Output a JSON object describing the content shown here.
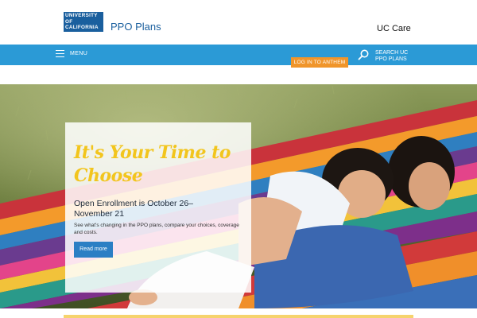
{
  "header": {
    "logo_lines": [
      "UNIVERSITY",
      "OF",
      "CALIFORNIA"
    ],
    "site_title": "PPO Plans",
    "uc_care": "UC Care"
  },
  "nav": {
    "menu_label": "MENU",
    "login_label": "LOG IN TO ANTHEM",
    "search_label_line1": "SEARCH UC",
    "search_label_line2": "PPO PLANS",
    "search_icon": "search-icon",
    "menu_icon": "hamburger-icon"
  },
  "hero": {
    "headline": "It's Your Time to Choose",
    "subheading": "Open Enrollment is October 26–November 21",
    "description": "See what's changing in the PPO plans, compare your choices, coverage and costs.",
    "button_label": "Read more"
  },
  "colors": {
    "brand_blue": "#1a5f9e",
    "nav_blue": "#2b9ad6",
    "login_orange": "#f0952a",
    "headline_yellow": "#f2c51d",
    "button_blue": "#2b7fc4"
  }
}
